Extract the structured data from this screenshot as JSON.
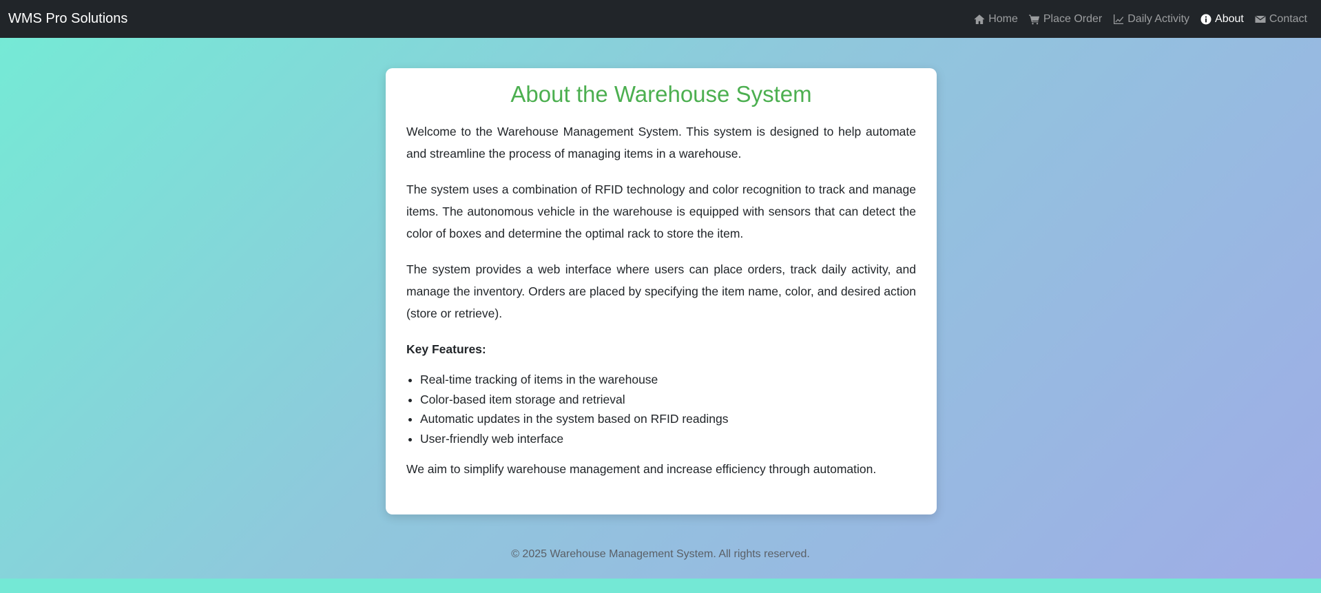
{
  "navbar": {
    "brand": "WMS Pro Solutions",
    "links": [
      {
        "label": "Home",
        "icon": "home-icon",
        "active": false
      },
      {
        "label": "Place Order",
        "icon": "cart-icon",
        "active": false
      },
      {
        "label": "Daily Activity",
        "icon": "chart-line-icon",
        "active": false
      },
      {
        "label": "About",
        "icon": "info-circle-icon",
        "active": true
      },
      {
        "label": "Contact",
        "icon": "envelope-icon",
        "active": false
      }
    ]
  },
  "about": {
    "title": "About the Warehouse System",
    "paragraphs": [
      "Welcome to the Warehouse Management System. This system is designed to help automate and streamline the process of managing items in a warehouse.",
      "The system uses a combination of RFID technology and color recognition to track and manage items. The autonomous vehicle in the warehouse is equipped with sensors that can detect the color of boxes and determine the optimal rack to store the item.",
      "The system provides a web interface where users can place orders, track daily activity, and manage the inventory. Orders are placed by specifying the item name, color, and desired action (store or retrieve)."
    ],
    "features_heading": "Key Features:",
    "features": [
      "Real-time tracking of items in the warehouse",
      "Color-based item storage and retrieval",
      "Automatic updates in the system based on RFID readings",
      "User-friendly web interface"
    ],
    "closing": "We aim to simplify warehouse management and increase efficiency through automation."
  },
  "footer": {
    "text": "© 2025 Warehouse Management System. All rights reserved."
  },
  "colors": {
    "navbar_bg": "#212529",
    "title_green": "#4caf50",
    "gradient_start": "#74ebd5",
    "gradient_end": "#9face6"
  }
}
